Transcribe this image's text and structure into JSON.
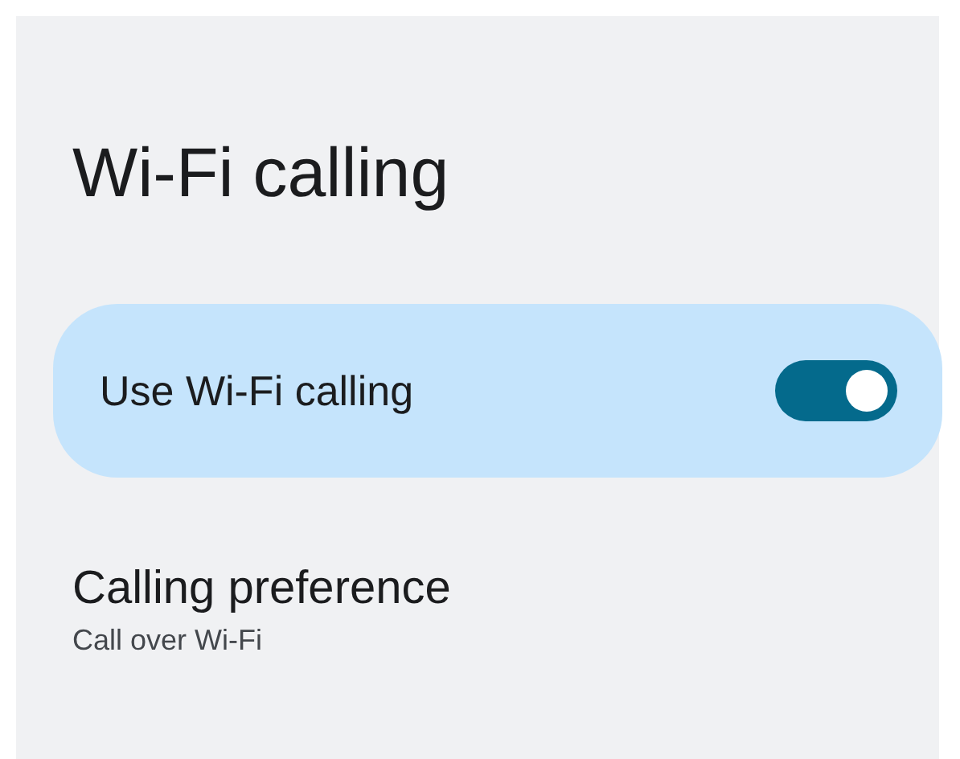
{
  "title": "Wi-Fi calling",
  "toggle_row": {
    "label": "Use Wi-Fi calling",
    "on": true
  },
  "preference": {
    "title": "Calling preference",
    "summary": "Call over Wi-Fi"
  }
}
